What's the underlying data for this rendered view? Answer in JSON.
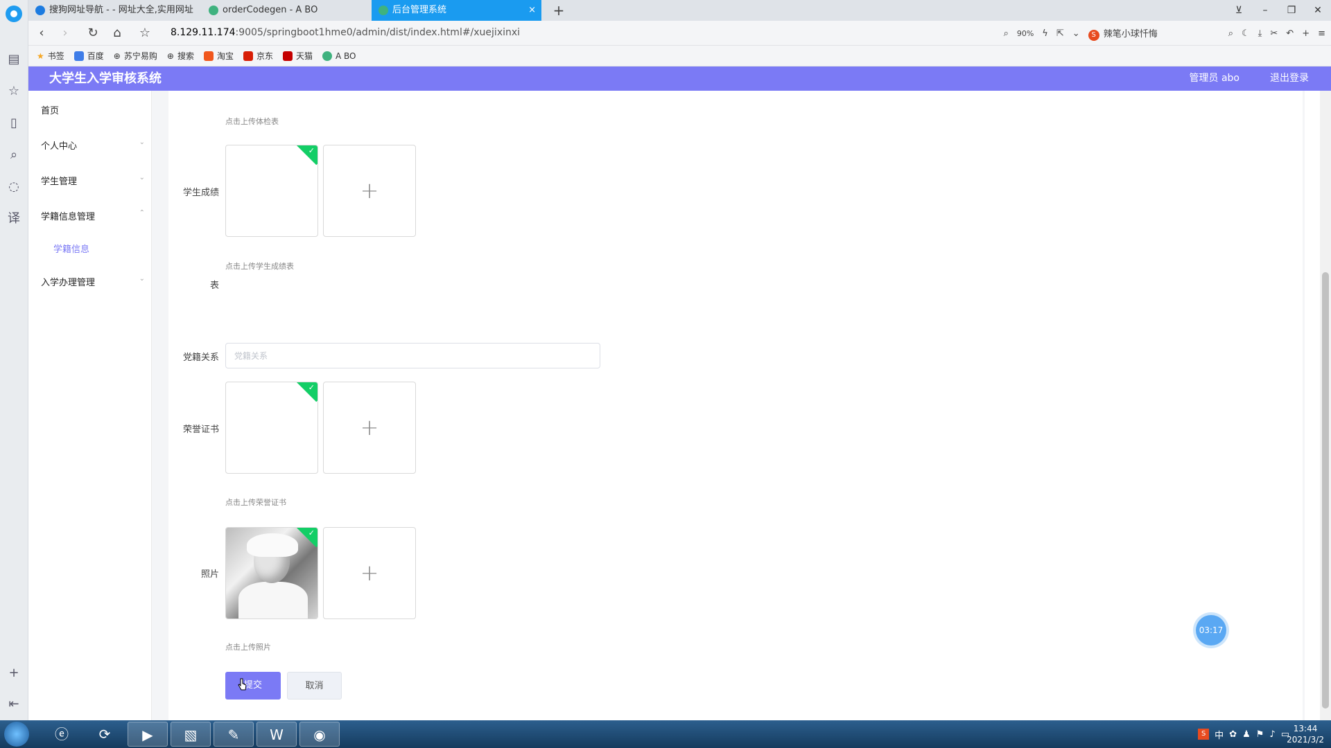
{
  "browser": {
    "tabs": [
      {
        "title": "搜狗网址导航 - - 网址大全,实用网址",
        "active": false
      },
      {
        "title": "orderCodegen - A BO",
        "active": false
      },
      {
        "title": "后台管理系统",
        "active": true
      }
    ],
    "tab_close": "×",
    "new_tab": "+",
    "url_host": "8.129.11.174",
    "url_path": ":9005/springboot1hme0/admin/dist/index.html#/xuejixinxi",
    "zoom": "90%",
    "search_engine_text": "辣笔小球忏悔",
    "bookmarks": [
      "书签",
      "百度",
      "苏宁易购",
      "搜索",
      "淘宝",
      "京东",
      "天猫",
      "A BO"
    ]
  },
  "app": {
    "title": "大学生入学审核系统",
    "user": "管理员 abo",
    "logout": "退出登录",
    "accent": "#7b7af5"
  },
  "menu": {
    "items": [
      {
        "label": "首页",
        "chevron": ""
      },
      {
        "label": "个人中心",
        "chevron": "⌄"
      },
      {
        "label": "学生管理",
        "chevron": "⌄"
      },
      {
        "label": "学籍信息管理",
        "chevron": "⌃"
      },
      {
        "label": "入学办理管理",
        "chevron": "⌄"
      }
    ],
    "sub_item": "学籍信息"
  },
  "form": {
    "hint_tijian": "点击上传体检表",
    "label_score": "学生成绩",
    "hint_score": "点击上传学生成绩表",
    "label_biao": "表",
    "label_party": "党籍关系",
    "placeholder_party": "党籍关系",
    "label_honor": "荣誉证书",
    "hint_honor": "点击上传荣誉证书",
    "label_photo": "照片",
    "hint_photo": "点击上传照片",
    "submit": "提交",
    "cancel": "取消",
    "add_symbol": "+"
  },
  "timer": "03:17",
  "taskbar": {
    "ime": "中",
    "time": "13:44",
    "date": "2021/3/2"
  }
}
